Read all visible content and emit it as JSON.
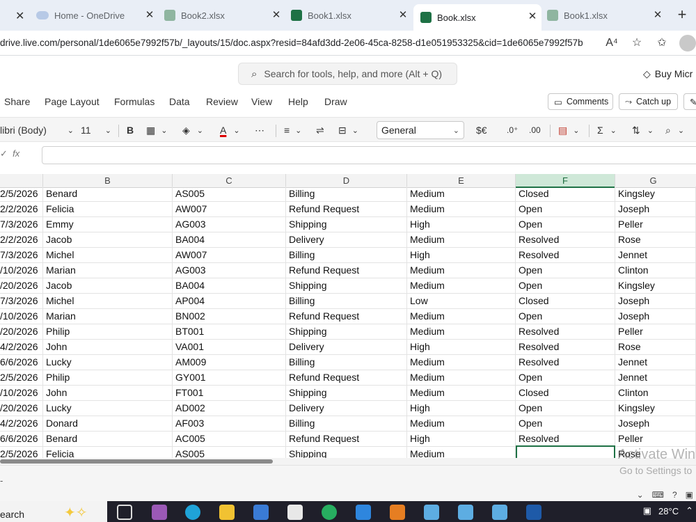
{
  "browser": {
    "tabs": [
      {
        "label": "Home - OneDrive",
        "icon": "onedrive-icon"
      },
      {
        "label": "Book2.xlsx",
        "icon": "excel-icon"
      },
      {
        "label": "Book1.xlsx",
        "icon": "excel-icon"
      },
      {
        "label": "Book.xlsx",
        "icon": "excel-icon",
        "active": true
      },
      {
        "label": "Book1.xlsx",
        "icon": "excel-icon"
      }
    ],
    "url": "drive.live.com/personal/1de6065e7992f57b/_layouts/15/doc.aspx?resid=84afd3dd-2e06-45ca-8258-d1e051953325&cid=1de6065e7992f57b",
    "read_aloud": "A⁴",
    "accent": "#1e7145"
  },
  "excel": {
    "search_placeholder": "Search for tools, help, and more (Alt + Q)",
    "buy_label": "Buy Micr",
    "menu": [
      "Share",
      "Page Layout",
      "Formulas",
      "Data",
      "Review",
      "View",
      "Help",
      "Draw"
    ],
    "comments_label": "Comments",
    "catchup_label": "Catch up",
    "font_name": "libri (Body)",
    "font_size": "11",
    "number_format": "General",
    "currency_symbol": "$€",
    "fx_label": "fx",
    "columns": [
      "B",
      "C",
      "D",
      "E",
      "F",
      "G"
    ],
    "selected_column": "F",
    "rows": [
      [
        "2/5/2026",
        "Benard",
        "AS005",
        "Billing",
        "Medium",
        "Closed",
        "Kingsley"
      ],
      [
        "2/2/2026",
        "Felicia",
        "AW007",
        "Refund Request",
        "Medium",
        "Open",
        "Joseph"
      ],
      [
        "7/3/2026",
        "Emmy",
        "AG003",
        "Shipping",
        "High",
        "Open",
        "Peller"
      ],
      [
        "2/2/2026",
        "Jacob",
        "BA004",
        "Delivery",
        "Medium",
        "Resolved",
        "Rose"
      ],
      [
        "7/3/2026",
        "Michel",
        "AW007",
        "Billing",
        "High",
        "Resolved",
        "Jennet"
      ],
      [
        "/10/2026",
        "Marian",
        "AG003",
        "Refund Request",
        "Medium",
        "Open",
        "Clinton"
      ],
      [
        "/20/2026",
        "Jacob",
        "BA004",
        "Shipping",
        "Medium",
        "Open",
        "Kingsley"
      ],
      [
        "7/3/2026",
        "Michel",
        "AP004",
        "Billing",
        "Low",
        "Closed",
        "Joseph"
      ],
      [
        "/10/2026",
        "Marian",
        "BN002",
        "Refund Request",
        "Medium",
        "Open",
        "Joseph"
      ],
      [
        "/20/2026",
        "Philip",
        "BT001",
        "Shipping",
        "Medium",
        "Resolved",
        "Peller"
      ],
      [
        "4/2/2026",
        "John",
        "VA001",
        "Delivery",
        "High",
        "Resolved",
        "Rose"
      ],
      [
        "6/6/2026",
        "Lucky",
        "AM009",
        "Billing",
        "Medium",
        "Resolved",
        "Jennet"
      ],
      [
        "2/5/2026",
        "Philip",
        "GY001",
        "Refund Request",
        "Medium",
        "Open",
        "Jennet"
      ],
      [
        "/10/2026",
        "John",
        "FT001",
        "Shipping",
        "Medium",
        "Closed",
        "Clinton"
      ],
      [
        "/20/2026",
        "Lucky",
        "AD002",
        "Delivery",
        "High",
        "Open",
        "Kingsley"
      ],
      [
        "4/2/2026",
        "Donard",
        "AF003",
        "Billing",
        "Medium",
        "Open",
        "Joseph"
      ],
      [
        "6/6/2026",
        "Benard",
        "AC005",
        "Refund Request",
        "High",
        "Resolved",
        "Peller"
      ],
      [
        "2/5/2026",
        "Felicia",
        "AS005",
        "Shipping",
        "Medium",
        "",
        "Rose"
      ]
    ],
    "sheet_tab": "-",
    "watermark_line1": "Activate Win",
    "watermark_line2": "Go to Settings to"
  },
  "taskbar": {
    "search_label": "earch",
    "temperature": "28°C"
  }
}
